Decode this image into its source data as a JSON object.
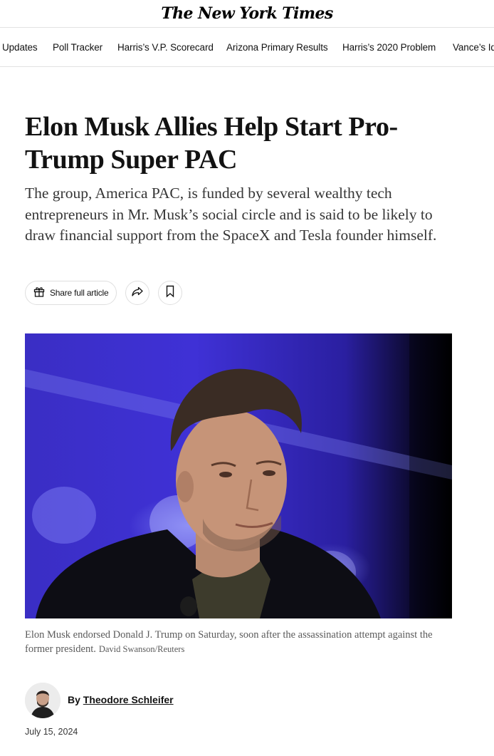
{
  "masthead": {
    "logo_text": "The New York Times"
  },
  "nav": {
    "items": [
      {
        "label": "Updates"
      },
      {
        "label": "Poll Tracker"
      },
      {
        "label": "Harris’s V.P. Scorecard"
      },
      {
        "label": "Arizona Primary Results"
      },
      {
        "label": "Harris’s 2020 Problem"
      },
      {
        "label": "Vance’s Id"
      }
    ]
  },
  "article": {
    "headline": "Elon Musk Allies Help Start Pro-Trump Super PAC",
    "summary": "The group, America PAC, is funded by several wealthy tech entrepreneurs in Mr. Musk’s social circle and is said to be likely to draw financial support from the SpaceX and Tesla founder himself.",
    "share_label": "Share full article",
    "caption": "Elon Musk endorsed Donald J. Trump on Saturday, soon after the assassination attempt against the former president.",
    "photo_credit": "David Swanson/Reuters",
    "byline_prefix": "By",
    "author": "Theodore Schleifer",
    "date": "July 15, 2024"
  },
  "icons": {
    "share": "gift-icon",
    "forward": "share-arrow-icon",
    "save": "bookmark-icon"
  },
  "colors": {
    "text": "#121212",
    "photo_bg": "#3f31d6",
    "muted": "#5a5a5a"
  }
}
